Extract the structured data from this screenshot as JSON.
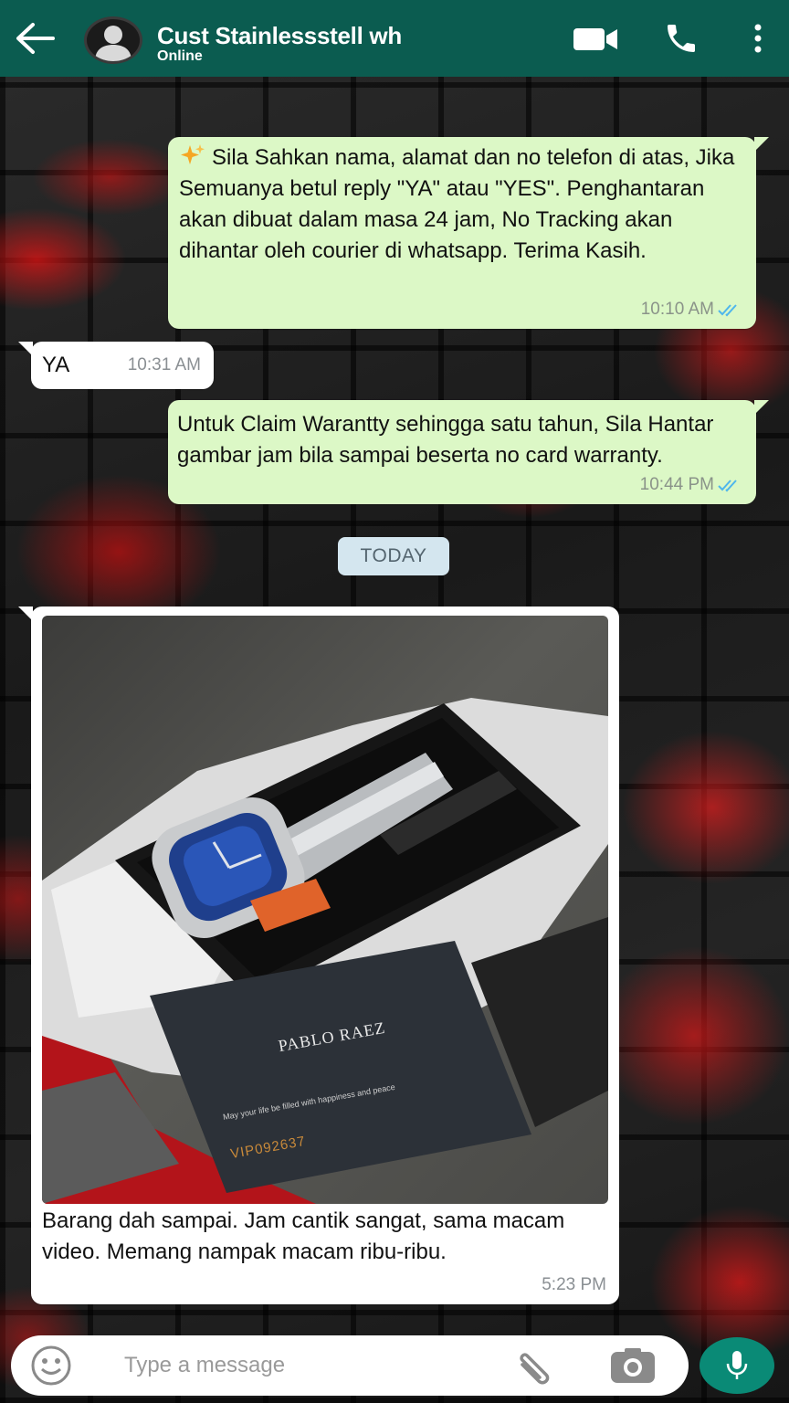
{
  "header": {
    "contact_name": "Cust Stainlessstell wh",
    "status": "Online",
    "icons": [
      "back-arrow-icon",
      "avatar-icon",
      "video-call-icon",
      "phone-icon",
      "more-vert-icon"
    ]
  },
  "messages": [
    {
      "direction": "outgoing",
      "text": "Sila Sahkan nama, alamat dan no telefon di atas, Jika Semuanya betul reply \"YA\" atau \"YES\". Penghantaran akan dibuat dalam masa 24 jam, No Tracking akan dihantar oleh courier di whatsapp. Terima Kasih.",
      "time": "10:10 AM",
      "status": "read",
      "emoji": "sparkles-icon"
    },
    {
      "direction": "incoming",
      "text": "YA",
      "time": "10:31 AM"
    },
    {
      "direction": "outgoing",
      "text": "Untuk Claim Warantty sehingga satu tahun, Sila Hantar gambar jam bila sampai beserta no card warranty.",
      "time": "10:44 PM",
      "status": "read"
    },
    {
      "direction": "incoming",
      "type": "image",
      "image_card_brand": "PABLO RAEZ",
      "image_card_tagline": "May your life be filled with happiness and peace",
      "image_card_code": "VIP092637",
      "text": "Barang dah sampai. Jam cantik sangat, sama macam video. Memang nampak macam ribu-ribu.",
      "time": "5:23 PM"
    }
  ],
  "day_separator": "TODAY",
  "composer": {
    "placeholder": "Type a message",
    "icons": [
      "emoji-icon",
      "paperclip-icon",
      "camera-icon",
      "microphone-icon"
    ]
  },
  "colors": {
    "header": "#0b5c50",
    "outgoing_bubble": "#dcf8c6",
    "incoming_bubble": "#ffffff",
    "read_tick": "#4fb6ec",
    "mic_button": "#0a8a76",
    "day_chip": "#d4e6ef"
  }
}
